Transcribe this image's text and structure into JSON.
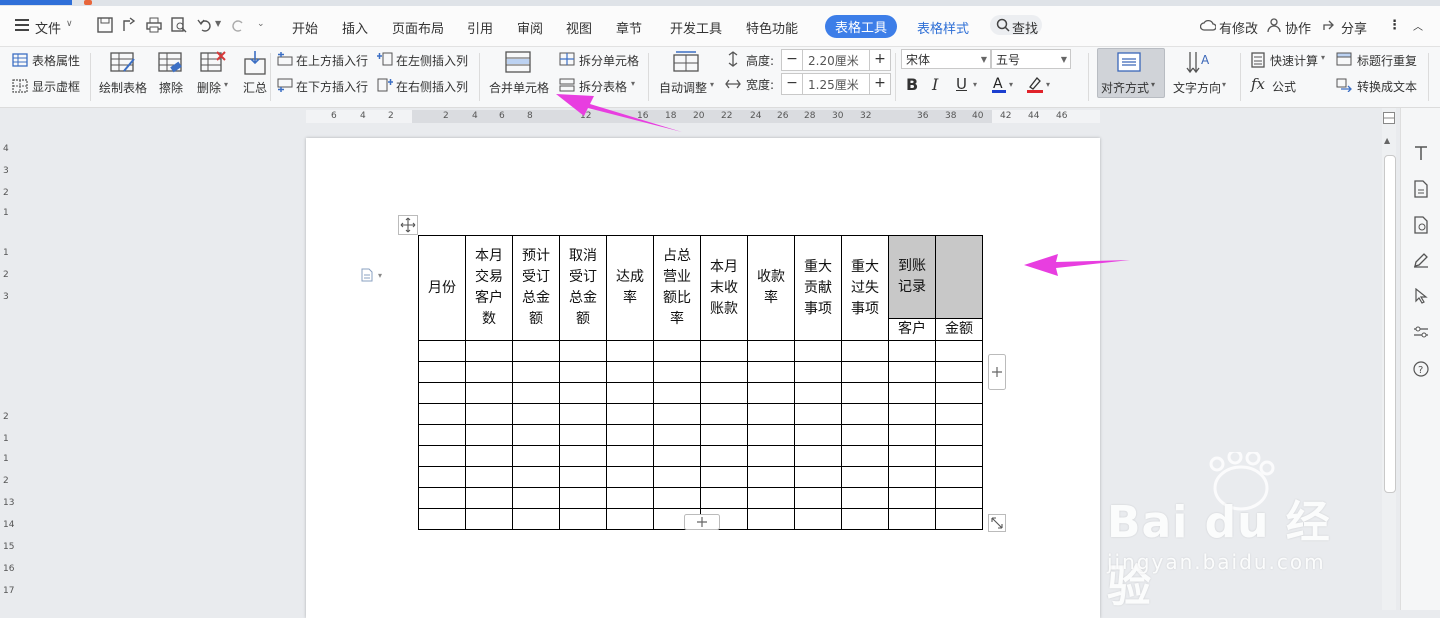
{
  "menu": {
    "file": "文件",
    "tabs": [
      "开始",
      "插入",
      "页面布局",
      "引用",
      "审阅",
      "视图",
      "章节",
      "开发工具",
      "特色功能"
    ],
    "active_tab": "表格工具",
    "style_tab": "表格样式",
    "search": "查找",
    "right": [
      "有修改",
      "协作",
      "分享"
    ]
  },
  "ribbon": {
    "table_props": "表格属性",
    "show_grid": "显示虚框",
    "draw_table": "绘制表格",
    "erase": "擦除",
    "delete": "删除",
    "summary": "汇总",
    "insert_above": "在上方插入行",
    "insert_below": "在下方插入行",
    "insert_left": "在左侧插入列",
    "insert_right": "在右侧插入列",
    "merge_cells": "合并单元格",
    "split_cells": "拆分单元格",
    "split_table": "拆分表格",
    "auto_adjust": "自动调整",
    "height_label": "高度:",
    "height_value": "2.20厘米",
    "width_label": "宽度:",
    "width_value": "1.25厘米",
    "font_name": "宋体",
    "font_size": "五号",
    "align": "对齐方式",
    "text_direction": "文字方向",
    "quick_calc": "快速计算",
    "title_repeat": "标题行重复",
    "formula": "公式",
    "convert_text": "转换成文本"
  },
  "ruler_h": [
    "6",
    "4",
    "2",
    "2",
    "4",
    "6",
    "8",
    "12",
    "16",
    "18",
    "20",
    "22",
    "24",
    "26",
    "28",
    "30",
    "32",
    "36",
    "38",
    "40",
    "42",
    "44",
    "46"
  ],
  "ruler_v": [
    "4",
    "3",
    "2",
    "1",
    "1",
    "2",
    "3",
    "1",
    "2",
    "1",
    "2",
    "13",
    "14",
    "15",
    "16",
    "17"
  ],
  "table": {
    "headers": [
      "月份",
      "本月交易客户数",
      "预计受订总金额",
      "取消受订总金额",
      "达成率",
      "占总营业额比率",
      "本月末收账款",
      "收款率",
      "重大贡献事项",
      "重大过失事项",
      "到账记录",
      ""
    ],
    "sub_headers": [
      "客户",
      "金额"
    ],
    "empty_rows": 9
  },
  "colors": {
    "accent": "#3d7ee8",
    "arrow": "#e83ee0",
    "shade": "#c8c8c8"
  },
  "watermark": {
    "brand": "Bai du 经验",
    "url": "jingyan.baidu.com"
  }
}
